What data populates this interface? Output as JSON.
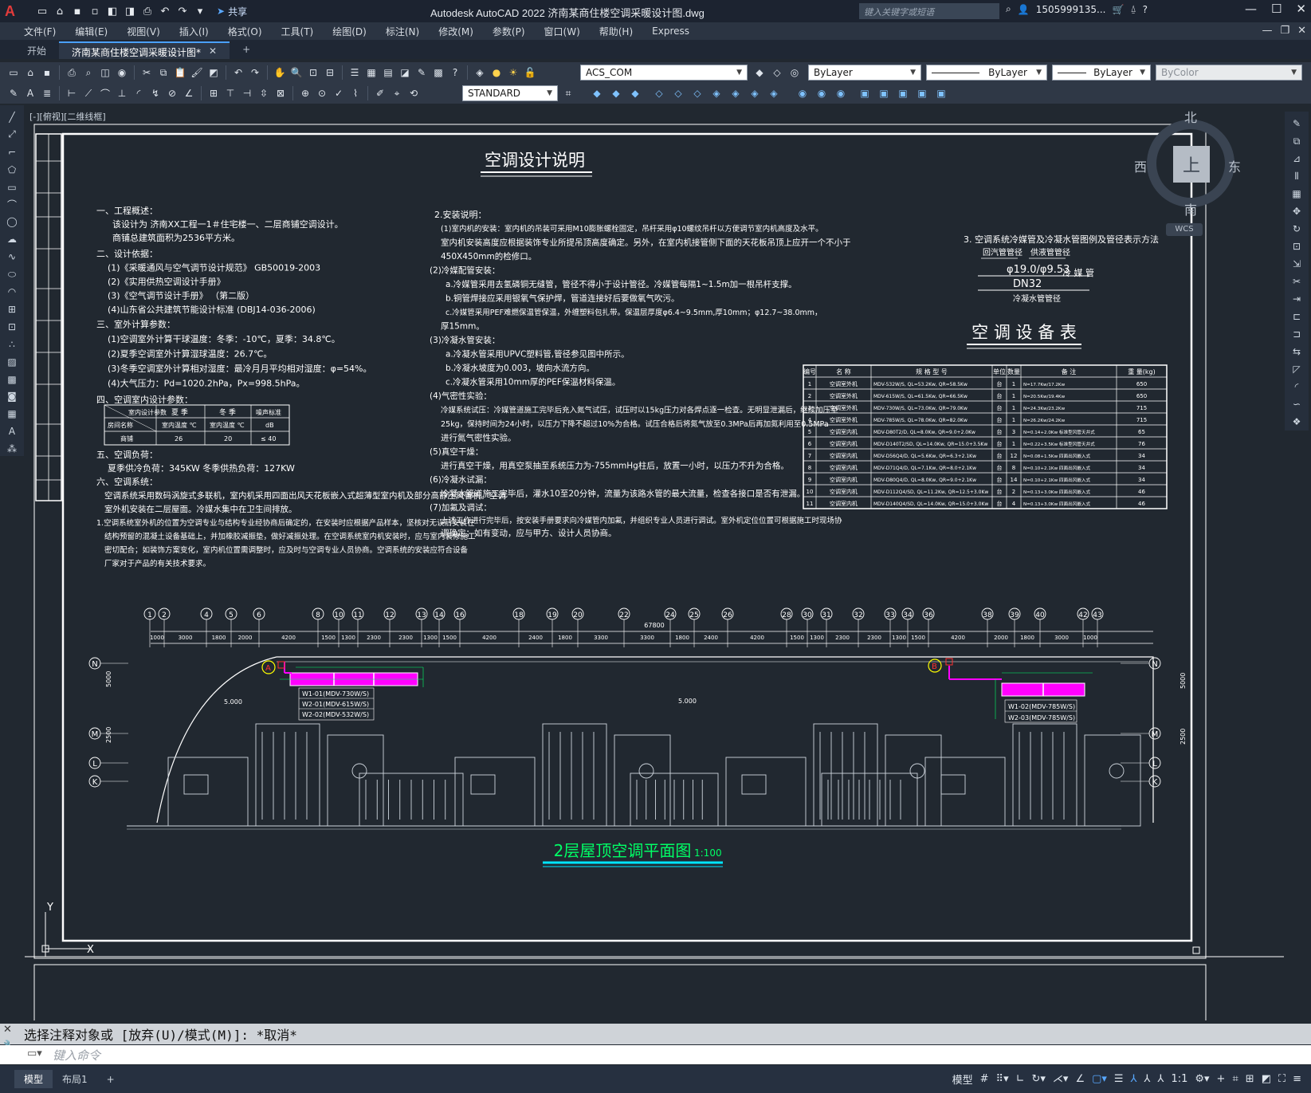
{
  "app": {
    "title": "Autodesk AutoCAD 2022    济南某商住楼空调采暖设计图.dwg",
    "logo": "A",
    "share_label": "共享",
    "search_placeholder": "键入关键字或短语",
    "user_label": "1505999135...",
    "window_controls": [
      "—",
      "☐",
      "✕"
    ]
  },
  "menu": {
    "items": [
      "文件(F)",
      "编辑(E)",
      "视图(V)",
      "插入(I)",
      "格式(O)",
      "工具(T)",
      "绘图(D)",
      "标注(N)",
      "修改(M)",
      "参数(P)",
      "窗口(W)",
      "帮助(H)",
      "Express"
    ]
  },
  "tabs": {
    "start": "开始",
    "document": "济南某商住楼空调采暖设计图*",
    "add": "+"
  },
  "toolbar": {
    "layer": "ACS_COM",
    "color": "ByLayer",
    "linetype": "ByLayer",
    "lineweight": "ByLayer",
    "plotstyle": "ByColor",
    "textstyle": "STANDARD"
  },
  "viewport": {
    "label": "[-][俯视][二维线框]"
  },
  "viewcube": {
    "north": "北",
    "south": "南",
    "east": "东",
    "west": "西",
    "face": "上",
    "wcs": "WCS"
  },
  "drawing": {
    "main_title": "空调设计说明",
    "section1_title": "一、工程概述：",
    "section1_lines": [
      "该设计为          济南XX工程一1＃住宅楼一、二层商铺空调设计。",
      "商铺总建筑面积为2536平方米。"
    ],
    "section2_title": "二、设计依据：",
    "section2_lines": [
      "(1)《采暖通风与空气调节设计规范》 GB50019-2003",
      "(2)《实用供热空调设计手册》",
      "(3)《空气调节设计手册》   （第二版）",
      "(4)山东省公共建筑节能设计标准 (DBJ14-036-2006)"
    ],
    "section3_title": "三、室外计算参数：",
    "section3_lines": [
      "(1)空调室外计算干球温度：冬季：-10℃，夏季：34.8℃。",
      "(2)夏季空调室外计算湿球温度：26.7℃。",
      "(3)冬季空调室外计算相对湿度：最冷月月平均相对湿度：φ=54%。",
      "(4)大气压力：Pd=1020.2hPa，Px=998.5hPa。"
    ],
    "section4_title": "四、空调室内设计参数：",
    "indoor_table": {
      "headers": [
        "室内设计参数",
        "夏 季",
        "冬 季",
        "噪声标准"
      ],
      "subheaders": [
        "房间名称",
        "室内温度 ℃",
        "室内温度 ℃",
        "dB"
      ],
      "row": [
        "商铺",
        "26",
        "20",
        "≤ 40"
      ]
    },
    "section5_title": "五、空调负荷：",
    "section5_lines": [
      "夏季供冷负荷：345KW        冬季供热负荷：127KW"
    ],
    "section6_title": "六、空调系统：",
    "section6_lines": [
      "空调系统采用数码涡旋式多联机，室内机采用四面出风天花板嵌入式超薄型室内机及部分高静压风管机。空调",
      "室外机安装在二层屋面。冷媒水集中在卫生间排放。",
      "1.空调系统室外机的位置为空调专业与结构专业经协商后确定的，在安装时应根据产品样本，坚核对无误后安装在",
      "结构预留的混凝土设备基础上，并加橡胶减振垫，做好减振处理。在空调系统室内机安装时，应与室内装修施工",
      "密切配合；如装饰方案变化，室内机位置需调整时，应及时与空调专业人员协商。空调系统的安装应符合设备",
      "厂家对于产品的有关技术要求。"
    ],
    "install_title": "2.安装说明：",
    "install_lines": [
      "(1)室内机的安装：室内机的吊装可采用M10膨胀螺栓固定，吊杆采用φ10螺纹吊杆以方便调节室内机高度及水平。",
      "室内机安装高度应根据装饰专业所提吊顶高度确定。另外，在室内机接管侧下面的天花板吊顶上应开一个不小于",
      "450X450mm的检修口。",
      "(2)冷媒配管安装：",
      "a.冷媒管采用去氢磷铜无缝管，管径不得小于设计管径。冷媒管每隔1~1.5m加一根吊杆支撑。",
      "b.铜管焊接应采用银氧气保护焊，管道连接好后要做氧气吹污。",
      "c.冷媒管采用PEF难燃保温管保温，外缠塑料包扎带。保温层厚度φ6.4~9.5mm,厚10mm；φ12.7~38.0mm，",
      "厚15mm。",
      "(3)冷凝水管安装：",
      "a.冷凝水管采用UPVC塑料管,管径参见图中所示。",
      "b.冷凝水坡度为0.003，坡向水流方向。",
      "c.冷凝水管采用10mm厚的PEF保温材料保温。",
      "(4)气密性实验：",
      "冷媒系统试压：冷媒管道施工完毕后充入氮气试压，试压时以15kg压力对各焊点逐一检查。无明显泄漏后，继续加压至",
      "25kg，保持时间为24小时，以压力下降不超过10%为合格。试压合格后将氮气放至0.3MPa后再加氮利用至0.5MPa",
      "进行氮气密性实验。",
      "(5)真空干燥：",
      "进行真空干燥，用真空泵抽至系统压力为-755mmHg柱后，放置一小时，以压力不升为合格。",
      "(6)冷凝水试漏：",
      "冷凝水管道施工完毕后，灌水10至20分钟，流量为该路水管的最大流量，检查各接口是否有泄漏。",
      "(7)加氟及调试：",
      "上述工作进行完毕后，按安装手册要求向冷媒管内加氟，并组织专业人员进行调试。室外机定位位置可根据施工时现场协",
      "调确定；如有变动，应与甲方、设计人员协商。"
    ],
    "pipe_legend_title": "3.        空调系统冷媒管及冷凝水管图例及管径表示方法",
    "pipe_legend_labels": [
      "回汽管管径",
      "供液管管径",
      "φ19.0/φ9.53",
      "冷 媒 管",
      "DN32",
      "冷凝水管管径"
    ],
    "equip_title": "空 调 设 备 表",
    "equip_headers": [
      "编号",
      "名 称",
      "规 格 型 号",
      "单位",
      "数量",
      "备 注",
      "重 量(kg)"
    ],
    "equip_rows": [
      [
        "1",
        "空调室外机",
        "MDV-532W/S, QL=53.2Kw, QR=58.5Kw",
        "台",
        "1",
        "N=17.7Kw/17.2Kw",
        "650"
      ],
      [
        "2",
        "空调室外机",
        "MDV-615W/S, QL=61.5Kw, QR=66.5Kw",
        "台",
        "1",
        "N=20.5Kw/19.4Kw",
        "650"
      ],
      [
        "3",
        "空调室外机",
        "MDV-730W/S, QL=73.0Kw, QR=79.0Kw",
        "台",
        "1",
        "N=24.3Kw/23.2Kw",
        "715"
      ],
      [
        "4",
        "空调室外机",
        "MDV-785W/S, QL=78.0Kw, QR=82.0Kw",
        "台",
        "1",
        "N=26.2Kw/24.2Kw",
        "715"
      ],
      [
        "5",
        "空调室内机",
        "MDV-D80T2/D, QL=8.0Kw, QR=9.0+2.0Kw",
        "台",
        "3",
        "N=0.14+2.0Kw 标准型风管天井式",
        "65"
      ],
      [
        "6",
        "空调室内机",
        "MDV-D140T2/SD, QL=14.0Kw, QR=15.0+3.5Kw",
        "台",
        "1",
        "N=0.22+3.5Kw 标准型风管天井式",
        "76"
      ],
      [
        "7",
        "空调室内机",
        "MDV-D56Q4/D, QL=5.6Kw, QR=6.3+2.1Kw",
        "台",
        "12",
        "N=0.08+1.5Kw 四面出风嵌入式",
        "34"
      ],
      [
        "8",
        "空调室内机",
        "MDV-D71Q4/D, QL=7.1Kw, QR=8.0+2.1Kw",
        "台",
        "8",
        "N=0.10+2.1Kw 四面出风嵌入式",
        "34"
      ],
      [
        "9",
        "空调室内机",
        "MDV-D80Q4/D, QL=8.0Kw, QR=9.0+2.1Kw",
        "台",
        "14",
        "N=0.10+2.1Kw 四面出风嵌入式",
        "34"
      ],
      [
        "10",
        "空调室内机",
        "MDV-D112Q4/SD, QL=11.2Kw, QR=12.5+3.0Kw",
        "台",
        "2",
        "N=0.13+3.0Kw 四面出风嵌入式",
        "46"
      ],
      [
        "11",
        "空调室内机",
        "MDV-D140Q4/SD, QL=14.0Kw, QR=15.0+3.0Kw",
        "台",
        "4",
        "N=0.13+3.0Kw 四面出风嵌入式",
        "46"
      ]
    ],
    "grid_numbers": [
      "1",
      "2",
      "4",
      "5",
      "6",
      "8",
      "10",
      "11",
      "12",
      "13",
      "14",
      "16",
      "18",
      "19",
      "20",
      "22",
      "24",
      "25",
      "26",
      "28",
      "30",
      "31",
      "32",
      "33",
      "34",
      "36",
      "38",
      "39",
      "40",
      "42",
      "43"
    ],
    "dimensions": [
      "1000",
      "3000",
      "1800",
      "2000",
      "4200",
      "1500",
      "1300",
      "2300",
      "2300",
      "1300",
      "1500",
      "4200",
      "2400",
      "1800",
      "3300",
      "3300",
      "1800",
      "2400",
      "4200",
      "1500",
      "1300",
      "2300",
      "2300",
      "1300",
      "1500",
      "4200",
      "2000",
      "1800",
      "3000",
      "1000"
    ],
    "total_dim": "67800",
    "axis_letters_left": [
      "N",
      "M",
      "L",
      "K"
    ],
    "axis_letters_right": [
      "N",
      "M",
      "L",
      "K"
    ],
    "side_dims": [
      "5000",
      "2500"
    ],
    "unit_labels_left": [
      "W1-01(MDV-730W/S)",
      "W2-01(MDV-615W/S)",
      "W2-02(MDV-532W/S)"
    ],
    "unit_labels_right": [
      "W1-02(MDV-785W/S)",
      "W2-03(MDV-785W/S)"
    ],
    "markers": [
      "A",
      "B"
    ],
    "plan_title": "2层屋顶空调平面图",
    "plan_scale": "1:100",
    "elevation": "5.000",
    "ucs_y": "Y",
    "ucs_x": "X"
  },
  "command": {
    "history": "选择注释对象或 [放弃(U)/模式(M)]: *取消*",
    "input_placeholder": "键入命令"
  },
  "status": {
    "tabs": [
      "模型",
      "布局1",
      "+"
    ],
    "model_label": "模型",
    "scale": "1:1"
  },
  "colors": {
    "accent": "#4aa0ff",
    "magenta": "#ff00ff",
    "cyan": "#00e5ff",
    "green_title": "#00ff66",
    "red": "#ff3030"
  }
}
